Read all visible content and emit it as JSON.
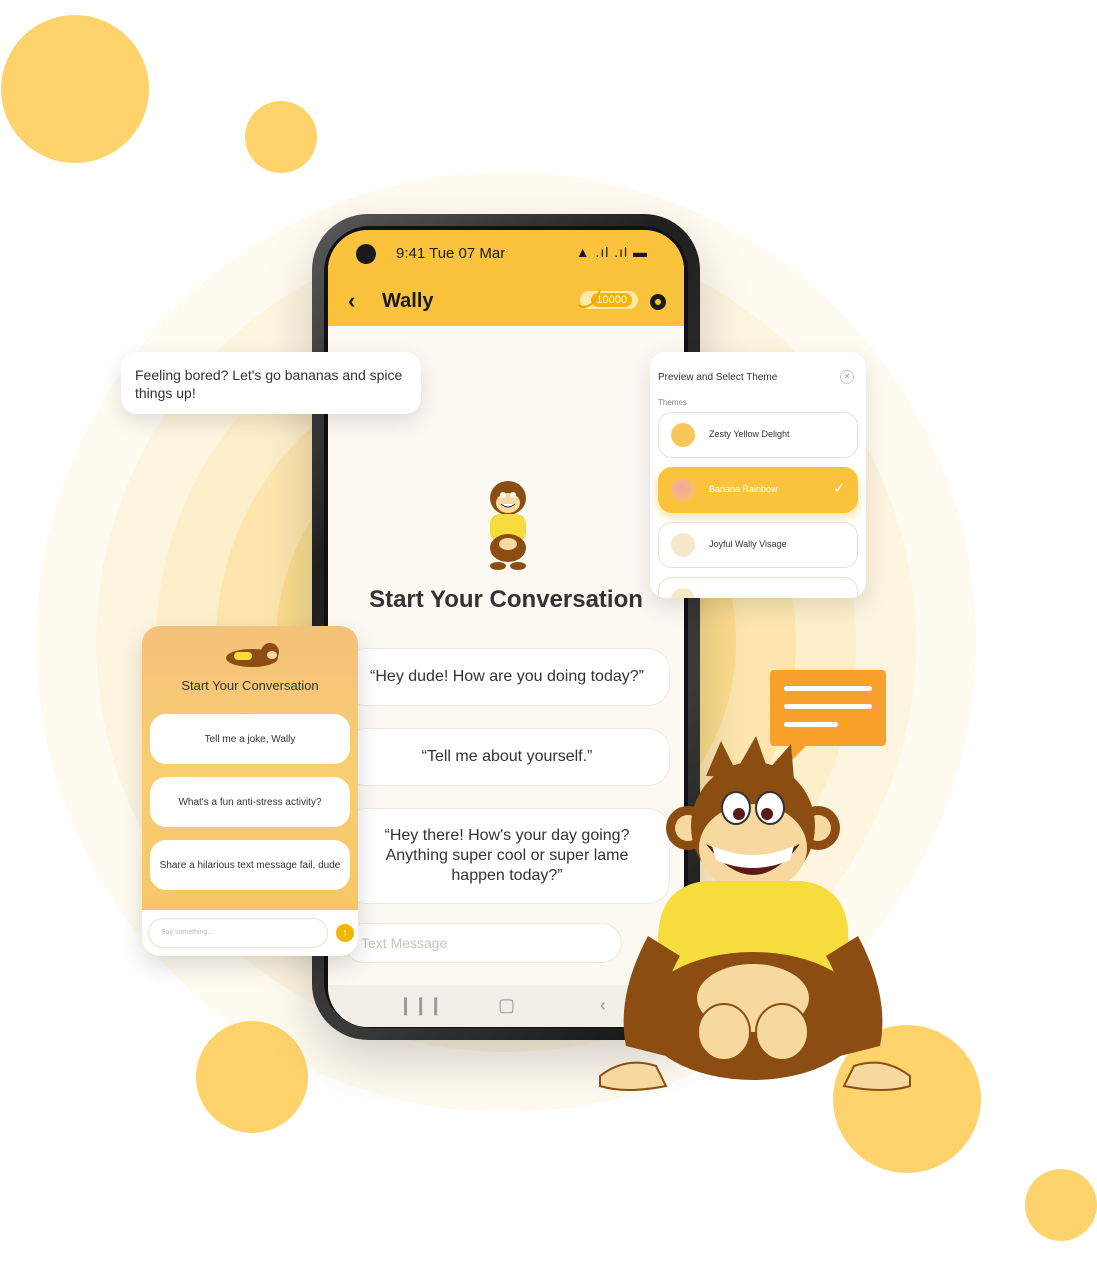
{
  "status_bar": {
    "time": "9:41 Tue 07 Mar",
    "icons": "▲ .ıl .ıl ▬"
  },
  "header": {
    "back_glyph": "‹",
    "title": "Wally",
    "coins": "10000"
  },
  "main": {
    "title": "Start Your Conversation",
    "suggestions": [
      "“Hey dude! How are you doing today?”",
      "“Tell me about yourself.”",
      "“Hey there! How's your day going? Anything super cool or super lame happen today?”"
    ],
    "input_placeholder": "Text Message"
  },
  "bubble": {
    "text": "Feeling bored? Let's go bananas and spice things up!"
  },
  "theme_panel": {
    "title": "Preview and Select Theme",
    "section": "Themes",
    "items": [
      {
        "label": "Zesty Yellow Delight",
        "color": "#F9C65A",
        "selected": false
      },
      {
        "label": "Banana Rainbow",
        "color": "#F6A8A0",
        "selected": true
      },
      {
        "label": "Joyful Wally Visage",
        "color": "#F6E9C9",
        "selected": false
      }
    ]
  },
  "card": {
    "title": "Start Your Conversation",
    "buttons": [
      "Tell me a joke, Wally",
      "What's a fun anti-stress activity?",
      "Share a hilarious text message fail, dude"
    ],
    "input_placeholder": "Say something..."
  },
  "colors": {
    "accent": "#FBC23C",
    "dots": "#FFD36B",
    "chat_icon": "#F9A12A",
    "monkey_brown": "#8B4D12",
    "shirt": "#F6DC3C"
  }
}
